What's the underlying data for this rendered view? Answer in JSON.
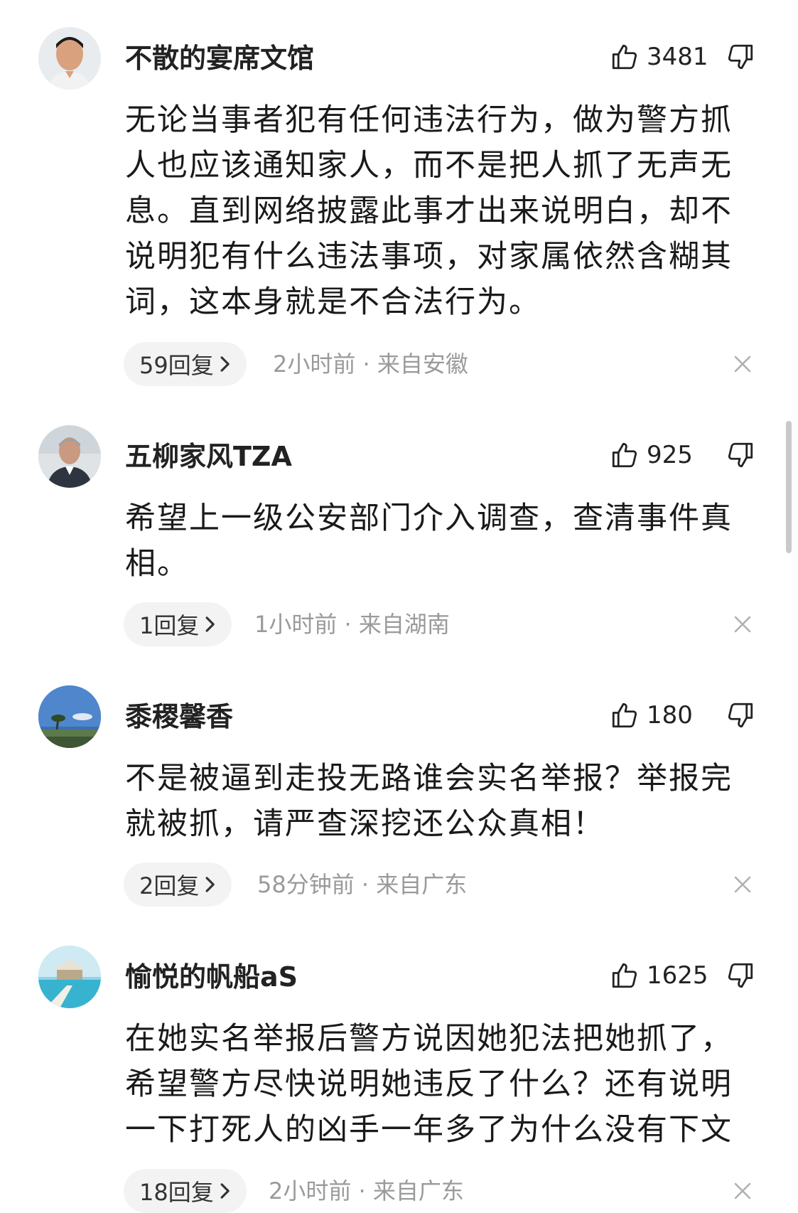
{
  "comments": [
    {
      "username": "不散的宴席文馆",
      "likes": "3481",
      "text": "无论当事者犯有任何违法行为，做为警方抓人也应该通知家人，而不是把人抓了无声无息。直到网络披露此事才出来说明白，却不说明犯有什么违法事项，对家属依然含糊其词，这本身就是不合法行为。",
      "replies": "59回复",
      "meta": "2小时前 · 来自安徽"
    },
    {
      "username": "五柳家风TZA",
      "likes": "925",
      "text": "希望上一级公安部门介入调查，查清事件真相。",
      "replies": "1回复",
      "meta": "1小时前 · 来自湖南"
    },
    {
      "username": "黍稷馨香",
      "likes": "180",
      "text": "不是被逼到走投无路谁会实名举报？举报完就被抓，请严查深挖还公众真相！",
      "replies": "2回复",
      "meta": "58分钟前 · 来自广东"
    },
    {
      "username": "愉悦的帆船aS",
      "likes": "1625",
      "text": "在她实名举报后警方说因她犯法把她抓了，希望警方尽快说明她违反了什么？还有说明一下打死人的凶手一年多了为什么没有下文",
      "replies": "18回复",
      "meta": "2小时前 · 来自广东"
    }
  ],
  "icons": {
    "like": "thumbs-up-icon",
    "dislike": "thumbs-down-icon",
    "reply_arrow": "chevron-right-icon",
    "dismiss": "close-icon"
  },
  "colors": {
    "text": "#1a1a1a",
    "meta": "#9a9a9a",
    "pill_bg": "#f3f3f3"
  }
}
